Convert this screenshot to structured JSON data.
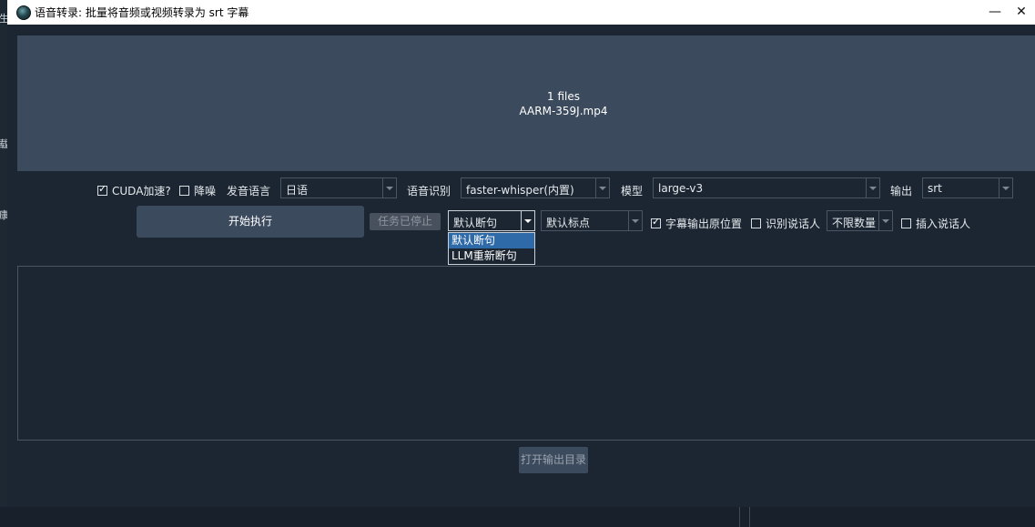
{
  "background_app": {
    "glyphs": [
      "生",
      "载",
      "康"
    ]
  },
  "window": {
    "title": "语音转录: 批量将音频或视频转录为 srt 字幕",
    "minimize": "—",
    "close": "✕"
  },
  "dropzone": {
    "count_text": "1 files",
    "file_name": "AARM-359J.mp4"
  },
  "options": {
    "cuda": {
      "label": "CUDA加速?",
      "checked": true
    },
    "denoise": {
      "label": "降噪",
      "checked": false
    },
    "language_label": "发音语言",
    "language_value": "日语",
    "recognition_label": "语音识别",
    "recognition_value": "faster-whisper(内置)",
    "model_label": "模型",
    "model_value": "large-v3",
    "output_label": "输出",
    "output_value": "srt"
  },
  "actions": {
    "start": "开始执行",
    "stop": "任务已停止",
    "split_value": "默认断句",
    "split_options": [
      "默认断句",
      "LLM重新断句"
    ],
    "punct_value": "默认标点",
    "subtitle_pos": {
      "label": "字幕输出原位置",
      "checked": true
    },
    "speaker_detect": {
      "label": "识别说话人",
      "checked": false
    },
    "speaker_count_value": "不限数量",
    "insert_speaker": {
      "label": "插入说话人",
      "checked": false
    },
    "open_output": "打开输出目录"
  },
  "colors": {
    "window_bg": "#1b2632",
    "panel": "#3c4a5d",
    "selected_option": "#2f6aa8"
  }
}
